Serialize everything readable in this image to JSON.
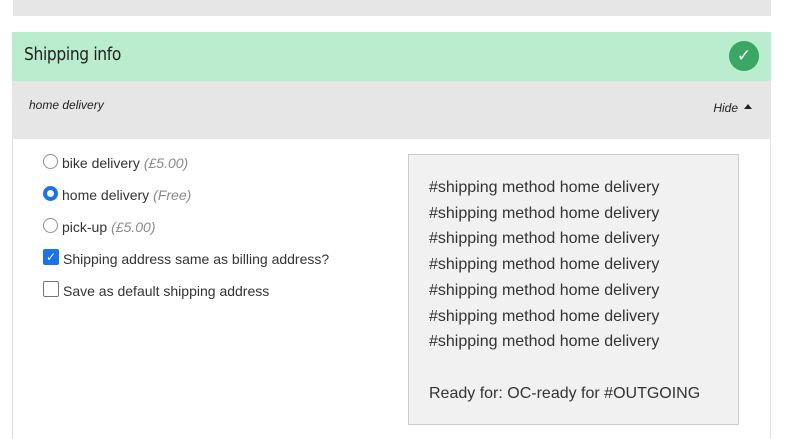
{
  "shipping": {
    "title": "Shipping info",
    "check_icon": "✓",
    "summary": "home delivery",
    "toggle_label": "Hide"
  },
  "options": [
    {
      "label": "bike delivery",
      "price": "(£5.00)",
      "selected": false
    },
    {
      "label": "home delivery",
      "price": "(Free)",
      "selected": true
    },
    {
      "label": "pick-up",
      "price": "(£5.00)",
      "selected": false
    }
  ],
  "checkboxes": [
    {
      "label": "Shipping address same as billing address?",
      "checked": true
    },
    {
      "label": "Save as default shipping address",
      "checked": false
    }
  ],
  "method_info": {
    "lines": [
      "#shipping method home delivery",
      "#shipping method home delivery",
      "#shipping method home delivery",
      "#shipping method home delivery",
      "#shipping method home delivery",
      "#shipping method home delivery",
      "#shipping method home delivery"
    ],
    "ready": "Ready for: OC-ready for #OUTGOING"
  },
  "colors": {
    "header_bg": "#baecce",
    "check_bg": "#3aa864",
    "accent": "#1a73e8"
  }
}
